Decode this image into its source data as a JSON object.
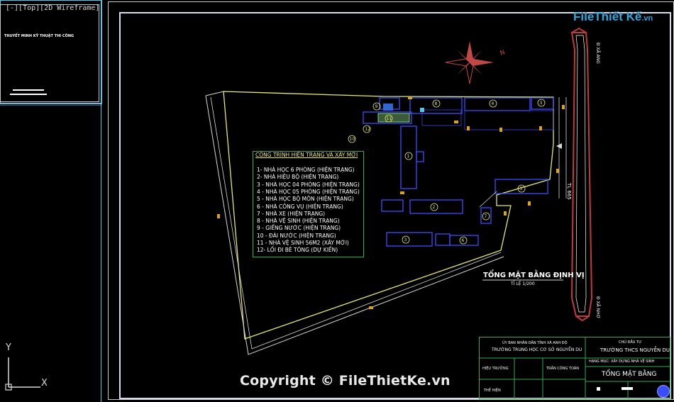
{
  "viewport": {
    "label": "[-][Top][2D Wireframe]"
  },
  "left_panel": {
    "title_line": "THUYẾT MINH KỸ THUẬT THI CÔNG"
  },
  "logo": {
    "brand": "FileThiết Kế",
    "suffix": ".vn"
  },
  "legend": {
    "heading": "CÔNG TRÌNH HIỆN TRẠNG VÀ XÂY MỚI",
    "items": [
      "1- NHÀ HỌC 6 PHÒNG (HIỆN TRẠNG)",
      "2- NHÀ HIỆU BỘ (HIỆN TRẠNG)",
      "3 - NHÀ HỌC 04 PHÒNG (HIỆN TRẠNG)",
      "4 - NHÀ HỌC 05 PHÒNG (HIỆN TRẠNG)",
      "5 - NHÀ HỌC BỘ MÔN (HIỆN TRẠNG)",
      "6 - NHÀ CÔNG VỤ (HIỆN TRẠNG)",
      "7 - NHÀ XE (HIỆN TRẠNG)",
      "8 - NHÀ VỆ SINH (HIỆN TRẠNG)",
      "9 - GIẾNG NƯỚC (HIỆN TRẠNG)",
      "10 - ĐÀI NƯỚC (HIỆN TRẠNG)",
      "11 - NHÀ VỆ SINH 56M2 (XÂY MỚI)",
      "12- LỐI ĐI BÊ TÔNG (DỰ KIẾN)"
    ]
  },
  "plan": {
    "title": "TỔNG MẶT BẰNG ĐỊNH VỊ",
    "scale": "TỈ LỆ 1/200",
    "road_label": "TL 665",
    "road_top_label": "Đ XÃ ANG",
    "road_bottom_label": "Đ XÃ NHƠ",
    "building_numbers": [
      "1",
      "2",
      "3",
      "4",
      "5",
      "6",
      "7",
      "8",
      "9",
      "10",
      "11",
      "12"
    ]
  },
  "title_block": {
    "agency": "ỦY BAN NHÂN DÂN TỈNH XÃ ANH ĐỘ",
    "school_left": "TRƯỜNG TRUNG HỌC CƠ SỞ NGUYỄN DU",
    "label_owner": "CHỦ ĐẦU TƯ",
    "school_right": "TRƯỜNG THCS NGUYỄN DU",
    "project": "HẠNG MỤC: XÂY DỰNG NHÀ VỆ SINH",
    "row_principal": "HIỆU TRƯỞNG",
    "principal_name": "TRẦN CÔNG TOÀN",
    "drawing_title": "TỔNG MẶT BẰNG",
    "row_drawn": "THỂ HIỆN"
  },
  "ucs": {
    "y_label": "Y",
    "x_label": "X"
  },
  "watermark": "Copyright © FileThietKe.vn",
  "colors": {
    "background": "#000000",
    "site_boundary": "#e8e86a",
    "buildings": "#3a4cff",
    "legend_frame": "#2fae4a",
    "title_block": "#2fae4a",
    "frame": "#dfe8ff",
    "road": "#c23a3a",
    "north_arrow": "#c24848",
    "paving": "#d9a321"
  }
}
